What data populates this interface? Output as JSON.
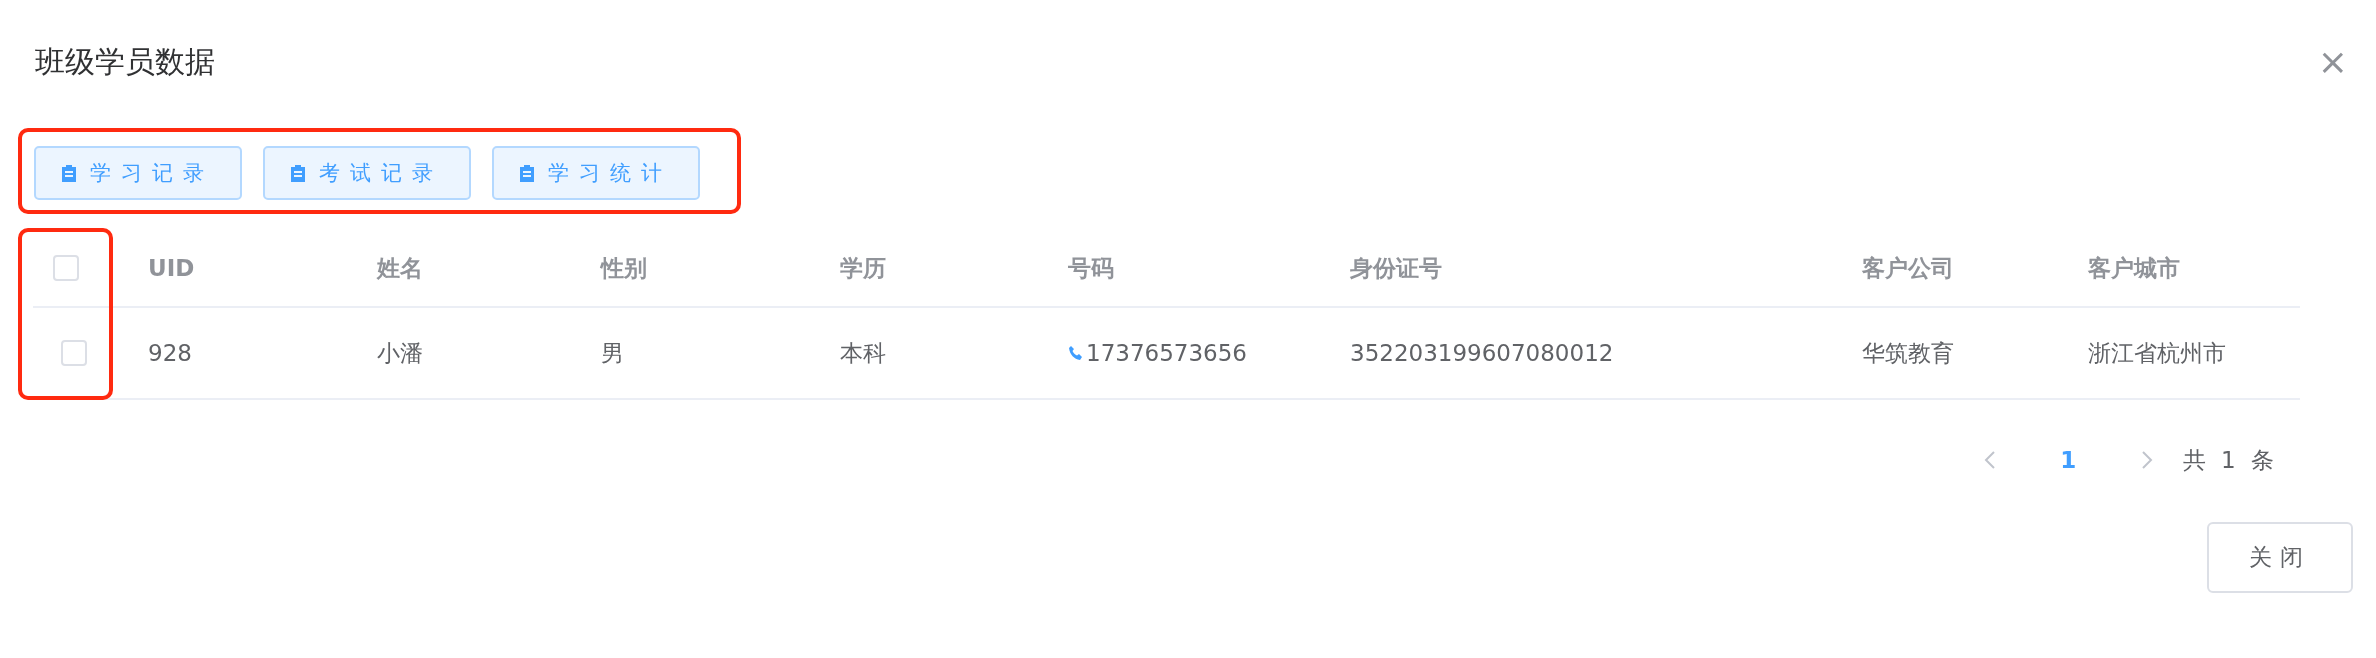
{
  "dialog": {
    "title": "班级学员数据",
    "close_icon": "×"
  },
  "toolbar": {
    "highlighted": true,
    "buttons": [
      "学习记录",
      "考试记录",
      "学习统计"
    ]
  },
  "table": {
    "select_column_highlighted": true,
    "select_all_checked": false,
    "columns": [
      "UID",
      "姓名",
      "性别",
      "学历",
      "号码",
      "身份证号",
      "客户公司",
      "客户城市"
    ],
    "rows": [
      {
        "checked": false,
        "cells": [
          "928",
          "小潘",
          "男",
          "本科",
          "17376573656",
          "352203199607080012",
          "华筑教育",
          "浙江省杭州市"
        ]
      }
    ]
  },
  "pagination": {
    "pages": [
      {
        "label": "1",
        "selected": true
      }
    ],
    "total": "共 1 条"
  },
  "footer": {
    "buttons": [
      "关闭"
    ]
  }
}
